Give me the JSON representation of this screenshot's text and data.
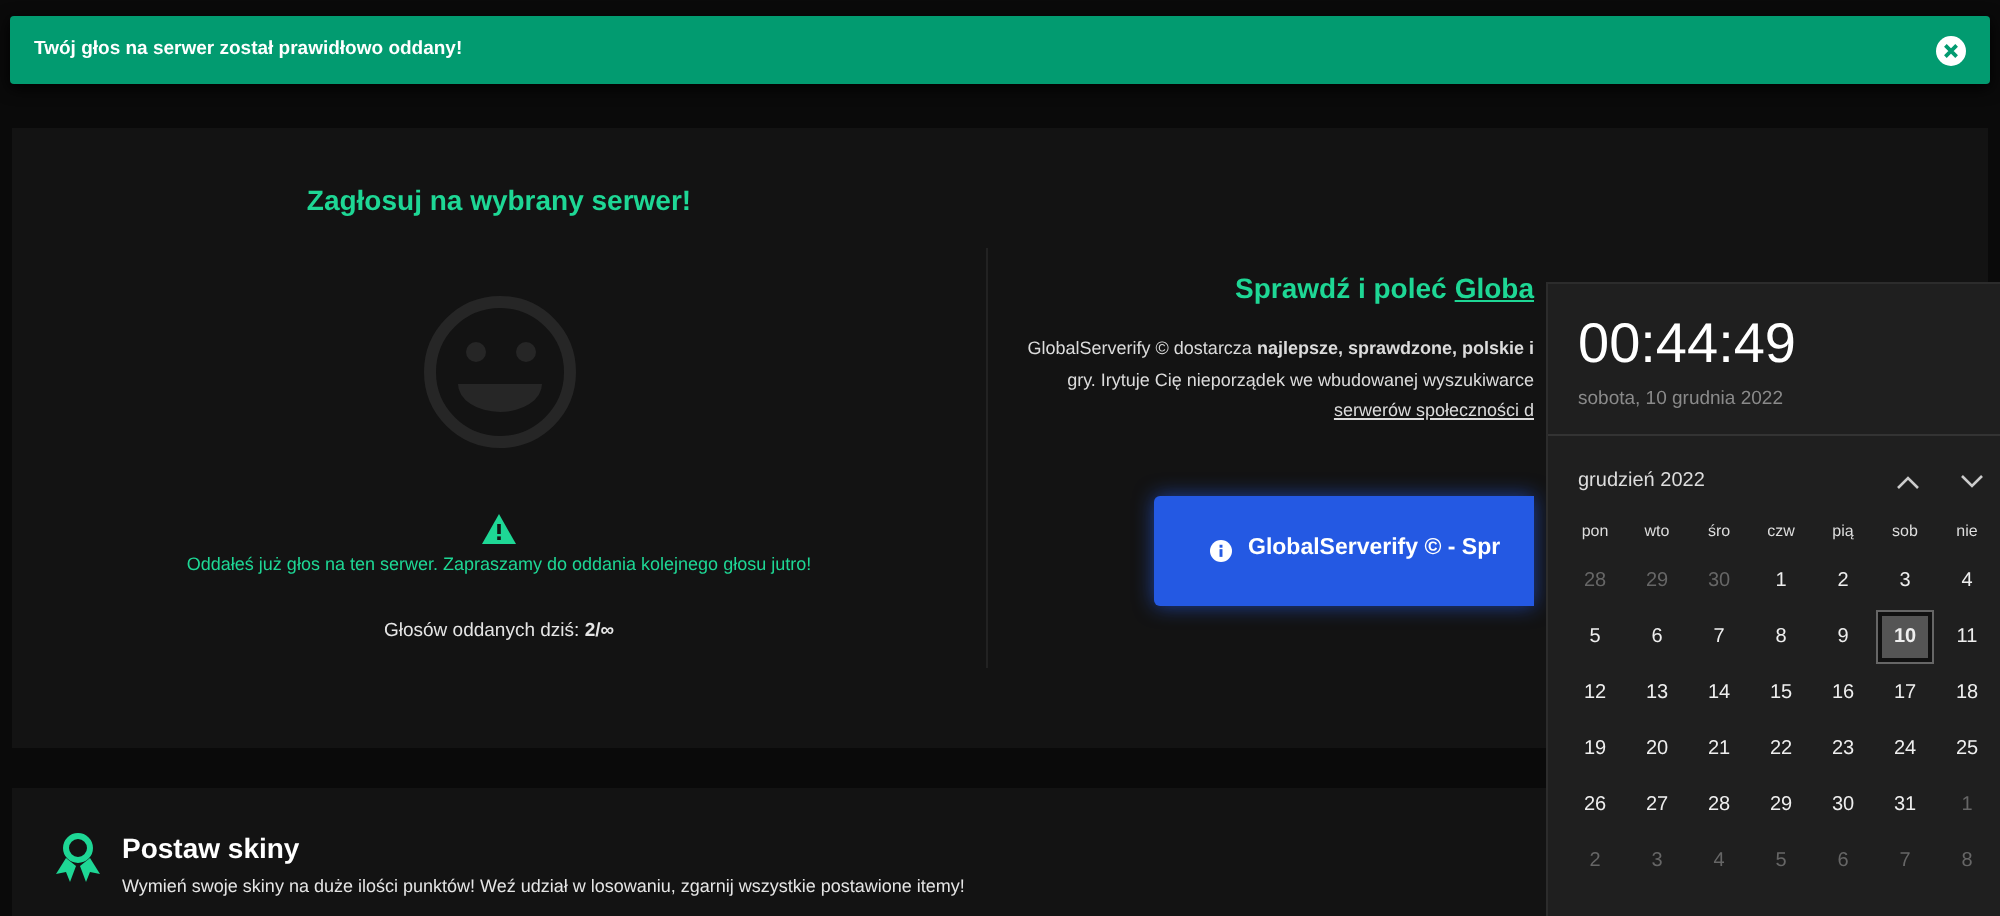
{
  "toast": {
    "message": "Twój głos na serwer został prawidłowo oddany!"
  },
  "vote_panel": {
    "title": "Zagłosuj na wybrany serwer!",
    "notice": "Oddałeś już głos na ten serwer. Zapraszamy do oddania kolejnego głosu jutro!",
    "counter": "Głosów oddanych dziś: **2/∞**"
  },
  "promo_panel": {
    "title": "Sprawdź i poleć",
    "title_link": "Globa",
    "lines": [
      {
        "kind": "text",
        "text": "GlobalServerify © dostarcza **najlepsze, sprawdzone, polskie i**"
      },
      {
        "kind": "text",
        "text": "gry. Irytuje Cię nieporządek we wbudowanej wyszukiwarce"
      },
      {
        "kind": "link",
        "text": "serwerów społeczności d"
      }
    ],
    "button": "GlobalServerify © - Spr"
  },
  "skins_panel": {
    "title": "Postaw skiny",
    "description": "Wymień swoje skiny na duże ilości punktów! Weź udział w losowaniu, zgarnij wszystkie postawione itemy!"
  },
  "clock": {
    "time": "00:44:49",
    "date": "sobota, 10 grudnia 2022",
    "month": "grudzień 2022",
    "weekdays": [
      "pon",
      "wto",
      "śro",
      "czw",
      "pią",
      "sob",
      "nie"
    ],
    "days": [
      {
        "label": "28",
        "muted": true,
        "selected": false
      },
      {
        "label": "29",
        "muted": true,
        "selected": false
      },
      {
        "label": "30",
        "muted": true,
        "selected": false
      },
      {
        "label": "1",
        "muted": false,
        "selected": false
      },
      {
        "label": "2",
        "muted": false,
        "selected": false
      },
      {
        "label": "3",
        "muted": false,
        "selected": false
      },
      {
        "label": "4",
        "muted": false,
        "selected": false
      },
      {
        "label": "5",
        "muted": false,
        "selected": false
      },
      {
        "label": "6",
        "muted": false,
        "selected": false
      },
      {
        "label": "7",
        "muted": false,
        "selected": false
      },
      {
        "label": "8",
        "muted": false,
        "selected": false
      },
      {
        "label": "9",
        "muted": false,
        "selected": false
      },
      {
        "label": "10",
        "muted": false,
        "selected": true
      },
      {
        "label": "11",
        "muted": false,
        "selected": false
      },
      {
        "label": "12",
        "muted": false,
        "selected": false
      },
      {
        "label": "13",
        "muted": false,
        "selected": false
      },
      {
        "label": "14",
        "muted": false,
        "selected": false
      },
      {
        "label": "15",
        "muted": false,
        "selected": false
      },
      {
        "label": "16",
        "muted": false,
        "selected": false
      },
      {
        "label": "17",
        "muted": false,
        "selected": false
      },
      {
        "label": "18",
        "muted": false,
        "selected": false
      },
      {
        "label": "19",
        "muted": false,
        "selected": false
      },
      {
        "label": "20",
        "muted": false,
        "selected": false
      },
      {
        "label": "21",
        "muted": false,
        "selected": false
      },
      {
        "label": "22",
        "muted": false,
        "selected": false
      },
      {
        "label": "23",
        "muted": false,
        "selected": false
      },
      {
        "label": "24",
        "muted": false,
        "selected": false
      },
      {
        "label": "25",
        "muted": false,
        "selected": false
      },
      {
        "label": "26",
        "muted": false,
        "selected": false
      },
      {
        "label": "27",
        "muted": false,
        "selected": false
      },
      {
        "label": "28",
        "muted": false,
        "selected": false
      },
      {
        "label": "29",
        "muted": false,
        "selected": false
      },
      {
        "label": "30",
        "muted": false,
        "selected": false
      },
      {
        "label": "31",
        "muted": false,
        "selected": false
      },
      {
        "label": "1",
        "muted": true,
        "selected": false
      },
      {
        "label": "2",
        "muted": true,
        "selected": false
      },
      {
        "label": "3",
        "muted": true,
        "selected": false
      },
      {
        "label": "4",
        "muted": true,
        "selected": false
      },
      {
        "label": "5",
        "muted": true,
        "selected": false
      },
      {
        "label": "6",
        "muted": true,
        "selected": false
      },
      {
        "label": "7",
        "muted": true,
        "selected": false
      },
      {
        "label": "8",
        "muted": true,
        "selected": false
      }
    ]
  }
}
